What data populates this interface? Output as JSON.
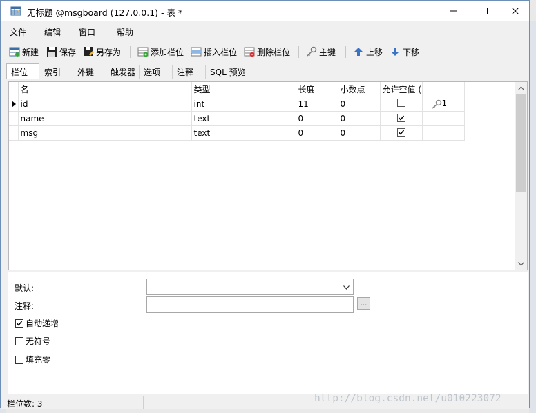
{
  "window": {
    "title": "无标题 @msgboard (127.0.0.1) - 表 *"
  },
  "menu": [
    "文件",
    "编辑",
    "窗口",
    "帮助"
  ],
  "toolbar": {
    "new": "新建",
    "save": "保存",
    "save_as": "另存为",
    "add_field": "添加栏位",
    "insert_field": "插入栏位",
    "delete_field": "删除栏位",
    "primary_key": "主键",
    "move_up": "上移",
    "move_down": "下移"
  },
  "tabs": [
    "栏位",
    "索引",
    "外键",
    "触发器",
    "选项",
    "注释",
    "SQL 预览"
  ],
  "grid": {
    "headers": [
      "名",
      "类型",
      "长度",
      "小数点",
      "允许空值 ("
    ],
    "rows": [
      {
        "name": "id",
        "type": "int",
        "length": "11",
        "decimals": "0",
        "nullable": false,
        "key": "1",
        "current": true
      },
      {
        "name": "name",
        "type": "text",
        "length": "0",
        "decimals": "0",
        "nullable": true,
        "key": "",
        "current": false
      },
      {
        "name": "msg",
        "type": "text",
        "length": "0",
        "decimals": "0",
        "nullable": true,
        "key": "",
        "current": false
      }
    ]
  },
  "props": {
    "default_label": "默认:",
    "default_value": "",
    "comment_label": "注释:",
    "comment_value": "",
    "browse_label": "...",
    "auto_increment_label": "自动递增",
    "auto_increment": true,
    "unsigned_label": "无符号",
    "unsigned": false,
    "zerofill_label": "填充零",
    "zerofill": false
  },
  "status": {
    "field_count": "栏位数: 3"
  },
  "watermark": "http://blog.csdn.net/u010223072"
}
